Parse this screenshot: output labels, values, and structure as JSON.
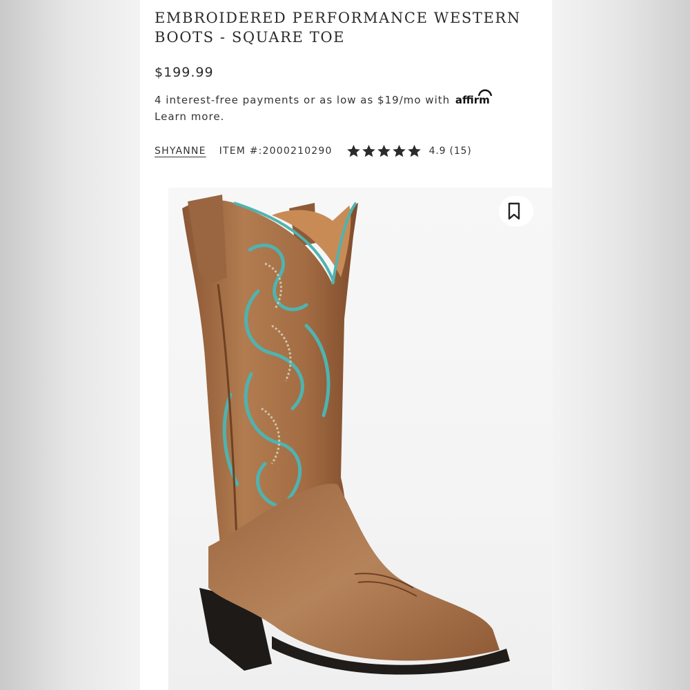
{
  "product": {
    "title": "EMBROIDERED PERFORMANCE WESTERN BOOTS - SQUARE TOE",
    "price": "$199.99",
    "affirm": {
      "text": "4 interest-free payments or as low as $19/mo with",
      "logo": "affirm",
      "learn_more": "Learn more."
    },
    "brand": "SHYANNE",
    "item_number": "ITEM #:2000210290",
    "rating": {
      "value": 4.9,
      "stars_shown": 5,
      "text": "4.9 (15)"
    }
  },
  "icons": {
    "bookmark": "bookmark-icon",
    "star": "star-icon"
  },
  "colors": {
    "background": "#ffffff",
    "text": "#2b2b2b",
    "boot_leather": "#a46e45",
    "embroidery": "#4fb3b0"
  }
}
